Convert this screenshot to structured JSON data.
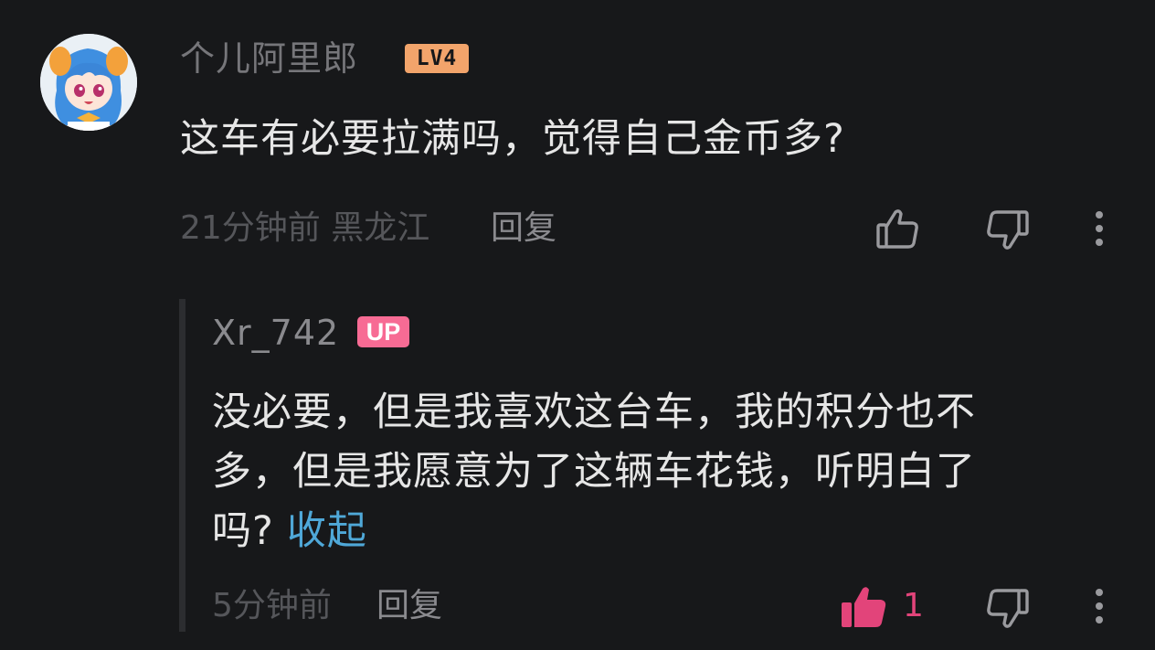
{
  "comment": {
    "username": "个儿阿里郎",
    "level_badge": "LV4",
    "text": "这车有必要拉满吗，觉得自己金币多?",
    "time": "21分钟前",
    "location": "黑龙江",
    "reply_label": "回复",
    "icons": [
      "avatar",
      "thumbs-up-icon",
      "thumbs-down-icon",
      "more-options-icon"
    ]
  },
  "reply": {
    "username": "Xr_742",
    "badge": "UP",
    "text_lines": [
      "没必要，但是我喜欢这台车，我的积分也不",
      "多，但是我愿意为了这辆车花钱，听明白了",
      "吗?"
    ],
    "collapse_label": "收起",
    "time": "5分钟前",
    "reply_label": "回复",
    "like_count": "1",
    "liked": true,
    "icons": [
      "thumbs-up-filled-icon",
      "thumbs-down-icon",
      "more-options-icon"
    ]
  },
  "colors": {
    "background": "#17181a",
    "level_badge": "#f2a46b",
    "up_badge": "#f76b94",
    "liked": "#e2447a",
    "link": "#4fa8d8"
  }
}
